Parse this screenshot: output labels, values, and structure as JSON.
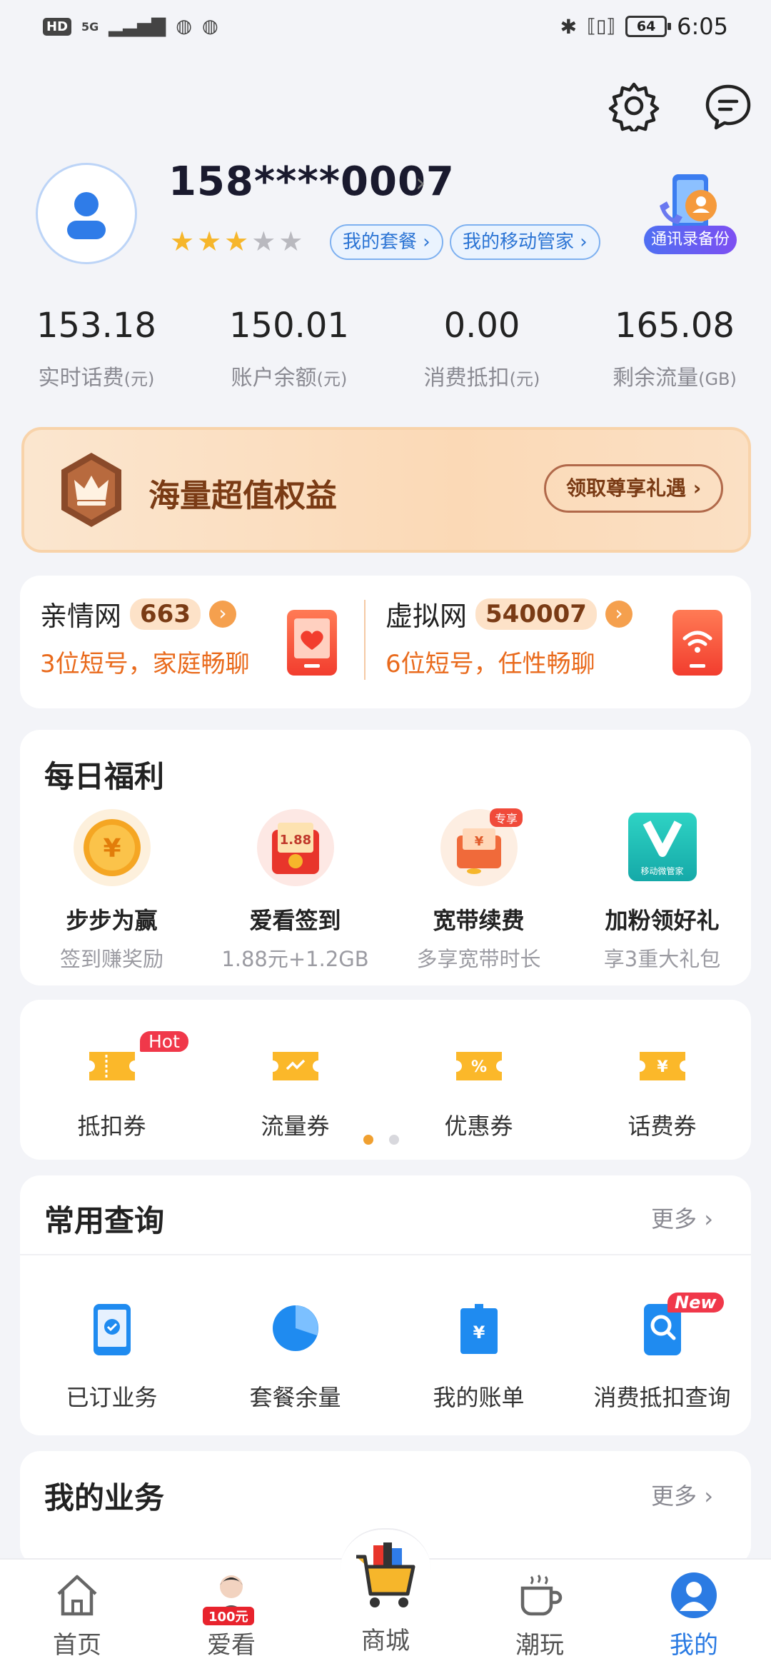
{
  "status_bar": {
    "left_chips": [
      "HD",
      "5G"
    ],
    "time": "6:05",
    "battery": "64"
  },
  "header": {
    "phone": "158****0007",
    "stars_filled": 3,
    "stars_total": 5,
    "pill_plan": "我的套餐 ›",
    "pill_manager": "我的移动管家 ›",
    "backup_label": "通讯录备份",
    "icons": [
      "settings-icon",
      "message-icon"
    ]
  },
  "stats": [
    {
      "value": "153.18",
      "label": "实时话费",
      "unit": "(元)"
    },
    {
      "value": "150.01",
      "label": "账户余额",
      "unit": "(元)"
    },
    {
      "value": "0.00",
      "label": "消费抵扣",
      "unit": "(元)"
    },
    {
      "value": "165.08",
      "label": "剩余流量",
      "unit": "(GB)"
    }
  ],
  "banner": {
    "title": "海量超值权益",
    "button": "领取尊享礼遇 ›"
  },
  "network": {
    "family": {
      "title": "亲情网",
      "badge": "663",
      "sub": "3位短号，家庭畅聊"
    },
    "virtual": {
      "title": "虚拟网",
      "badge": "540007",
      "sub": "6位短号，任性畅聊"
    }
  },
  "daily": {
    "title": "每日福利",
    "items": [
      {
        "title": "步步为赢",
        "sub": "签到赚奖励",
        "icon": "coin-icon"
      },
      {
        "title": "爱看签到",
        "sub": "1.88元+1.2GB",
        "icon": "red-envelope-icon"
      },
      {
        "title": "宽带续费",
        "sub": "多享宽带时长",
        "icon": "broadband-envelope-icon",
        "tag": "专享"
      },
      {
        "title": "加粉领好礼",
        "sub": "享3重大礼包",
        "icon": "v-logo-icon",
        "logo_text": "移动微管家"
      }
    ]
  },
  "coupons": {
    "items": [
      {
        "label": "抵扣券",
        "tag": "Hot"
      },
      {
        "label": "流量券"
      },
      {
        "label": "优惠券"
      },
      {
        "label": "话费券"
      }
    ],
    "page": 1,
    "pages": 2
  },
  "queries": {
    "title": "常用查询",
    "more": "更多",
    "items": [
      {
        "label": "已订业务",
        "icon": "subscribed-phone-icon"
      },
      {
        "label": "套餐余量",
        "icon": "pie-chart-icon"
      },
      {
        "label": "我的账单",
        "icon": "bill-icon"
      },
      {
        "label": "消费抵扣查询",
        "icon": "search-doc-icon",
        "tag": "New"
      }
    ]
  },
  "business": {
    "title": "我的业务",
    "more": "更多"
  },
  "tabs": [
    {
      "label": "首页",
      "icon": "home-icon"
    },
    {
      "label": "爱看",
      "icon": "watch-avatar-icon",
      "tag": "100元"
    },
    {
      "label": "商城",
      "icon": "shopping-cart-icon"
    },
    {
      "label": "潮玩",
      "icon": "coffee-cup-icon"
    },
    {
      "label": "我的",
      "icon": "profile-icon",
      "active": true
    }
  ],
  "colors": {
    "accent": "#2b7be3",
    "orange": "#e96a1c",
    "gold": "#f6b62b",
    "brown": "#7a3b15"
  }
}
